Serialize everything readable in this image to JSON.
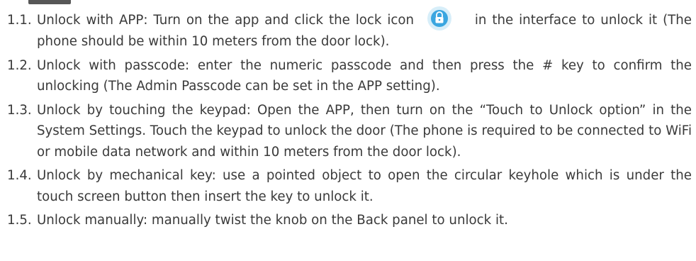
{
  "items": [
    {
      "number": "1.1.",
      "text_before_icon": "Unlock with APP: Turn on the app and click the lock icon",
      "text_after_icon": "in the interface to unlock it (The phone should be within 10 meters from the door lock).",
      "icon": "lock-icon",
      "icon_color": "#3aa6e0"
    },
    {
      "number": "1.2.",
      "text": "Unlock with passcode: enter the numeric passcode and then press the # key to confirm the unlocking (The Admin Passcode can be set in the APP setting)."
    },
    {
      "number": "1.3.",
      "text": "Unlock by touching the keypad: Open the APP, then turn on the “Touch to Unlock option” in the System Settings. Touch the keypad to unlock the door (The phone is required to be connected to WiFi or mobile data network and within 10 meters from the door lock)."
    },
    {
      "number": "1.4.",
      "text": "Unlock by mechanical key: use a pointed object to open the circular keyhole which is under the touch screen button then insert the key to unlock it."
    },
    {
      "number": "1.5.",
      "text": "Unlock manually: manually twist the knob on the Back panel to unlock it."
    }
  ]
}
